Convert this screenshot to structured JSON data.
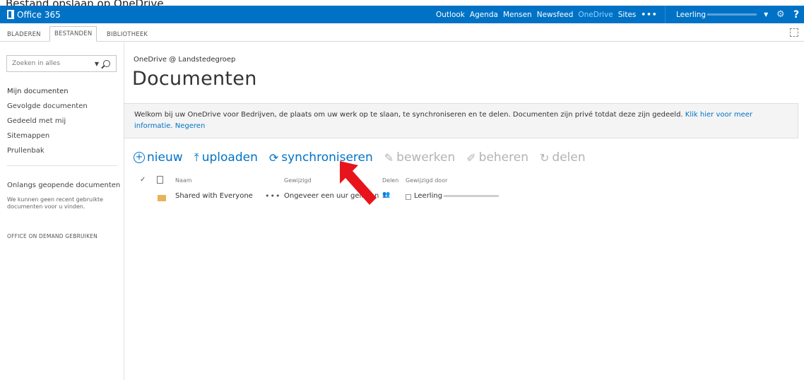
{
  "caption": "Bestand opslaan op OneDrive",
  "suite": {
    "brand": "Office 365",
    "nav": [
      "Outlook",
      "Agenda",
      "Mensen",
      "Newsfeed",
      "OneDrive",
      "Sites"
    ],
    "active": "OneDrive",
    "more": "•••",
    "user": "Leerling",
    "gear_icon": "gear-icon",
    "help": "?"
  },
  "ribbon": {
    "tabs": [
      "BLADEREN",
      "BESTANDEN",
      "BIBLIOTHEEK"
    ],
    "selected": "BESTANDEN"
  },
  "leftnav": {
    "search_placeholder": "Zoeken in alles",
    "items": [
      "Mijn documenten",
      "Gevolgde documenten",
      "Gedeeld met mij",
      "Sitemappen",
      "Prullenbak"
    ],
    "recent_title": "Onlangs geopende documenten",
    "recent_text": "We kunnen geen recent gebruikte documenten voor u vinden.",
    "on_demand": "OFFICE ON DEMAND GEBRUIKEN"
  },
  "main": {
    "breadcrumb": "OneDrive @ Landstedegroep",
    "title": "Documenten",
    "banner": {
      "text": "Welkom bij uw OneDrive voor Bedrijven, de plaats om uw werk op te slaan, te synchroniseren en te delen. Documenten zijn privé totdat deze zijn gedeeld.",
      "link1": "Klik hier voor meer",
      "link1b": "informatie.",
      "link2": "Negeren"
    },
    "commands": {
      "new": "nieuw",
      "upload": "uploaden",
      "sync": "synchroniseren",
      "edit": "bewerken",
      "manage": "beheren",
      "share": "delen"
    },
    "columns": {
      "check": "✓",
      "name": "Naam",
      "modified": "Gewijzigd",
      "share": "Delen",
      "modified_by": "Gewijzigd door"
    },
    "rows": [
      {
        "name": "Shared with Everyone",
        "dots": "•••",
        "modified": "Ongeveer een uur geleden",
        "share_icon": "people-icon",
        "modified_by": "Leerling"
      }
    ]
  },
  "colors": {
    "suitebar": "#0072c6",
    "accent": "#0072c6",
    "arrow": "#e8141b",
    "folder": "#e6b35a"
  }
}
